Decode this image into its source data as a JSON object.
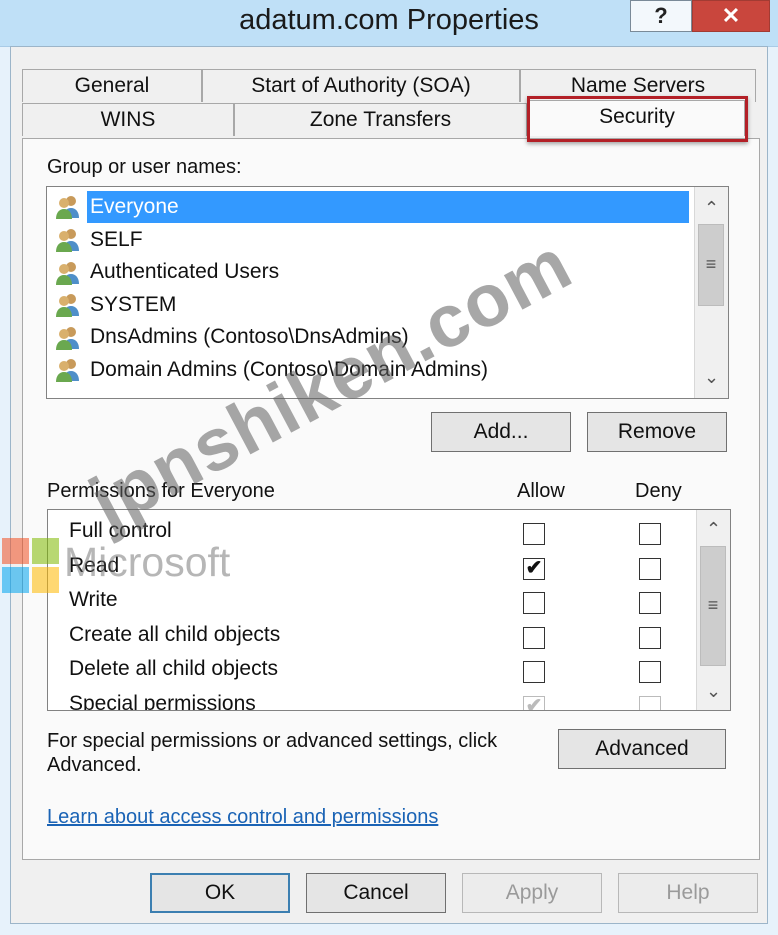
{
  "window": {
    "title": "adatum.com Properties",
    "help_glyph": "?",
    "close_glyph": "✕"
  },
  "tabs": {
    "row1": [
      "General",
      "Start of Authority (SOA)",
      "Name Servers"
    ],
    "row2": [
      "WINS",
      "Zone Transfers",
      "Security"
    ],
    "active": "Security"
  },
  "security": {
    "group_label": "Group or user names:",
    "users": [
      {
        "name": "Everyone",
        "selected": true
      },
      {
        "name": "SELF"
      },
      {
        "name": "Authenticated Users"
      },
      {
        "name": "SYSTEM"
      },
      {
        "name": "DnsAdmins (Contoso\\DnsAdmins)"
      },
      {
        "name": "Domain Admins (Contoso\\Domain Admins)"
      }
    ],
    "add_label": "Add...",
    "remove_label": "Remove",
    "permissions_label": "Permissions for Everyone",
    "allow_label": "Allow",
    "deny_label": "Deny",
    "permissions": [
      {
        "name": "Full control",
        "allow": false,
        "deny": false
      },
      {
        "name": "Read",
        "allow": true,
        "deny": false
      },
      {
        "name": "Write",
        "allow": false,
        "deny": false
      },
      {
        "name": "Create all child objects",
        "allow": false,
        "deny": false
      },
      {
        "name": "Delete all child objects",
        "allow": false,
        "deny": false
      },
      {
        "name": "Special permissions",
        "allow": true,
        "deny": false,
        "disabled": true
      }
    ],
    "advanced_text": "For special permissions or advanced settings, click Advanced.",
    "advanced_label": "Advanced",
    "learn_link": "Learn about access control and permissions"
  },
  "footer": {
    "ok_label": "OK",
    "cancel_label": "Cancel",
    "apply_label": "Apply",
    "help_label": "Help"
  },
  "watermark": {
    "logo_text": "Microsoft",
    "overlay_text": "jpnshiken.com"
  },
  "colors": {
    "titlebar": "#bfe0f7",
    "close": "#c9463d",
    "selection": "#3399ff",
    "highlight_box": "#b32027",
    "link": "#1a63b5"
  },
  "icons": {
    "user_group": "users-icon",
    "checkmark": "check-icon",
    "scroll_up": "chevron-up-icon",
    "scroll_down": "chevron-down-icon",
    "thumb_grip": "grip-icon"
  }
}
